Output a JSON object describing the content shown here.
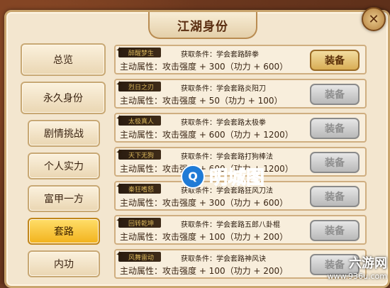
{
  "title": "江湖身份",
  "close_icon": "✕",
  "sidebar": {
    "items": [
      {
        "label": "总览",
        "active": false
      },
      {
        "label": "永久身份",
        "active": false
      },
      {
        "label": "剧情挑战",
        "active": false
      },
      {
        "label": "个人实力",
        "active": false
      },
      {
        "label": "富甲一方",
        "active": false
      },
      {
        "label": "套路",
        "active": true
      },
      {
        "label": "内功",
        "active": false
      }
    ]
  },
  "rows": [
    {
      "tag": "醉醒梦生",
      "condition": "获取条件：学会套路醉拳",
      "attr": "主动属性：攻击强度 + 300（功力 + 600）",
      "button": "装备",
      "enabled": true
    },
    {
      "tag": "烈日之刃",
      "condition": "获取条件：学会套路炎阳刀",
      "attr": "主动属性：攻击强度 + 50（功力 + 100）",
      "button": "装备",
      "enabled": false
    },
    {
      "tag": "太极真人",
      "condition": "获取条件：学会套路太极拳",
      "attr": "主动属性：攻击强度 + 600（功力 + 1200）",
      "button": "装备",
      "enabled": false
    },
    {
      "tag": "天下无狗",
      "condition": "获取条件：学会套路打狗棒法",
      "attr": "主动属性：攻击强度 + 600（功力 + 1200）",
      "button": "装备",
      "enabled": false
    },
    {
      "tag": "秦狂嗜怒",
      "condition": "获取条件：学会套路狂风刀法",
      "attr": "主动属性：攻击强度 + 300（功力 + 600）",
      "button": "装备",
      "enabled": false
    },
    {
      "tag": "回转乾坤",
      "condition": "获取条件：学会套路五郎八卦棍",
      "attr": "主动属性：攻击强度 + 100（功力 + 200）",
      "button": "装备",
      "enabled": false
    },
    {
      "tag": "风舞雷动",
      "condition": "获取条件：学会套路神风诀",
      "attr": "主动属性：攻击强度 + 100（功力 + 200）",
      "button": "装备",
      "enabled": false
    }
  ],
  "watermark": {
    "icon": "Q",
    "text": "明城图"
  },
  "site_logo": {
    "line1": "六游网",
    "line2": "www.936u.com"
  },
  "colors": {
    "active_tab": "#f2b21c",
    "equip_enabled": "#d9ad55",
    "equip_disabled": "#b9b9b9"
  }
}
